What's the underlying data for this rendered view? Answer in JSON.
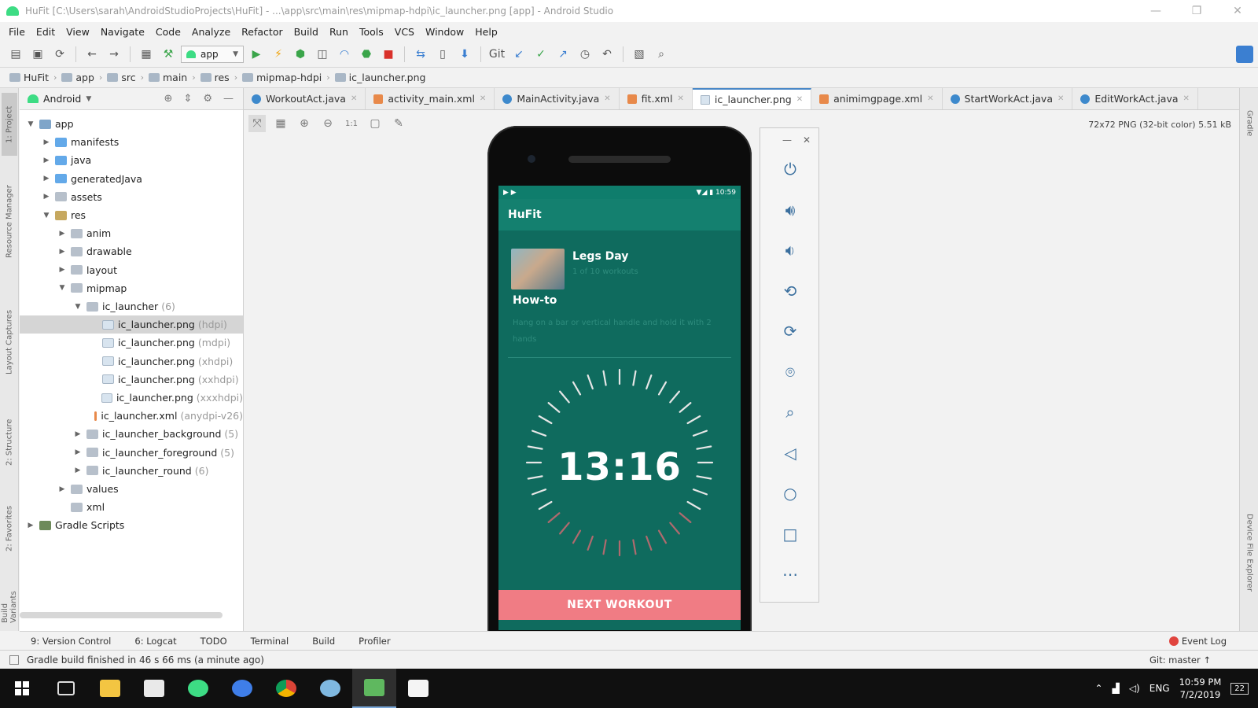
{
  "window": {
    "title": "HuFit [C:\\Users\\sarah\\AndroidStudioProjects\\HuFit] - ...\\app\\src\\main\\res\\mipmap-hdpi\\ic_launcher.png [app] - Android Studio",
    "minimize": "—",
    "maximize": "❐",
    "close": "✕"
  },
  "menu": [
    "File",
    "Edit",
    "View",
    "Navigate",
    "Code",
    "Analyze",
    "Refactor",
    "Build",
    "Run",
    "Tools",
    "VCS",
    "Window",
    "Help"
  ],
  "toolbar": {
    "run_config": "app"
  },
  "breadcrumb": [
    "HuFit",
    "app",
    "src",
    "main",
    "res",
    "mipmap-hdpi",
    "ic_launcher.png"
  ],
  "project_panel": {
    "view_mode": "Android",
    "tree": [
      {
        "label": "app",
        "note": "",
        "icon": "module",
        "arrow": "▼"
      },
      {
        "label": "manifests",
        "note": "",
        "icon": "folder-blue",
        "arrow": "▶"
      },
      {
        "label": "java",
        "note": "",
        "icon": "folder-blue",
        "arrow": "▶"
      },
      {
        "label": "generatedJava",
        "note": "",
        "icon": "folder-blue",
        "arrow": "▶"
      },
      {
        "label": "assets",
        "note": "",
        "icon": "folder",
        "arrow": "▶"
      },
      {
        "label": "res",
        "note": "",
        "icon": "folder-res",
        "arrow": "▼"
      },
      {
        "label": "anim",
        "note": "",
        "icon": "folder",
        "arrow": "▶"
      },
      {
        "label": "drawable",
        "note": "",
        "icon": "folder",
        "arrow": "▶"
      },
      {
        "label": "layout",
        "note": "",
        "icon": "folder",
        "arrow": "▶"
      },
      {
        "label": "mipmap",
        "note": "",
        "icon": "folder",
        "arrow": "▼"
      },
      {
        "label": "ic_launcher",
        "note": "(6)",
        "icon": "folder",
        "arrow": "▼"
      },
      {
        "label": "ic_launcher.png",
        "note": "(hdpi)",
        "icon": "png",
        "arrow": ""
      },
      {
        "label": "ic_launcher.png",
        "note": "(mdpi)",
        "icon": "png",
        "arrow": ""
      },
      {
        "label": "ic_launcher.png",
        "note": "(xhdpi)",
        "icon": "png",
        "arrow": ""
      },
      {
        "label": "ic_launcher.png",
        "note": "(xxhdpi)",
        "icon": "png",
        "arrow": ""
      },
      {
        "label": "ic_launcher.png",
        "note": "(xxxhdpi)",
        "icon": "png",
        "arrow": ""
      },
      {
        "label": "ic_launcher.xml",
        "note": "(anydpi-v26)",
        "icon": "xml",
        "arrow": ""
      },
      {
        "label": "ic_launcher_background",
        "note": "(5)",
        "icon": "folder",
        "arrow": "▶"
      },
      {
        "label": "ic_launcher_foreground",
        "note": "(5)",
        "icon": "folder",
        "arrow": "▶"
      },
      {
        "label": "ic_launcher_round",
        "note": "(6)",
        "icon": "folder",
        "arrow": "▶"
      },
      {
        "label": "values",
        "note": "",
        "icon": "folder",
        "arrow": "▶"
      },
      {
        "label": "xml",
        "note": "",
        "icon": "folder",
        "arrow": ""
      },
      {
        "label": "Gradle Scripts",
        "note": "",
        "icon": "gradle",
        "arrow": "▶"
      }
    ]
  },
  "left_stripe": [
    "1: Project",
    "Resource Manager",
    "Layout Captures",
    "2: Structure",
    "2: Favorites",
    "Build Variants"
  ],
  "right_stripe": [
    "Gradle",
    "Device File Explorer"
  ],
  "editor_tabs": [
    {
      "label": "WorkoutAct.java",
      "type": "java",
      "active": false
    },
    {
      "label": "activity_main.xml",
      "type": "xml",
      "active": false
    },
    {
      "label": "MainActivity.java",
      "type": "java",
      "active": false
    },
    {
      "label": "fit.xml",
      "type": "xml",
      "active": false
    },
    {
      "label": "ic_launcher.png",
      "type": "png",
      "active": true
    },
    {
      "label": "animimgpage.xml",
      "type": "xml",
      "active": false
    },
    {
      "label": "StartWorkAct.java",
      "type": "java",
      "active": false
    },
    {
      "label": "EditWorkAct.java",
      "type": "java",
      "active": false
    }
  ],
  "image_info": "72x72 PNG (32-bit color) 5.51 kB",
  "phone": {
    "status_left": "▶ ▶",
    "status_right": "▼◢ ▮ 10:59",
    "app_title": "HuFit",
    "workout_title": "Legs Day",
    "workout_sub": "1 of 10 workouts",
    "howto_title": "How-to",
    "howto_text": "Hang on a bar or vertical handle and hold it with 2 hands",
    "timer": "13:16",
    "next_button": "NEXT WORKOUT",
    "nav": [
      "◀",
      "●",
      "■"
    ]
  },
  "emulator_controls": [
    "power-icon",
    "volume-up-icon",
    "volume-down-icon",
    "rotate-left-icon",
    "rotate-right-icon",
    "camera-icon",
    "zoom-icon",
    "back-icon",
    "home-icon",
    "overview-icon",
    "more-icon"
  ],
  "bottom_tabs": [
    "9: Version Control",
    "6: Logcat",
    "TODO",
    "Terminal",
    "Build",
    "Profiler"
  ],
  "event_log": "Event Log",
  "status_message": "Gradle build finished in 46 s 66 ms (a minute ago)",
  "git_branch": "Git: master ↑",
  "taskbar": {
    "tray_lang": "ENG",
    "time": "10:59 PM",
    "date": "7/2/2019",
    "notif": "22"
  }
}
